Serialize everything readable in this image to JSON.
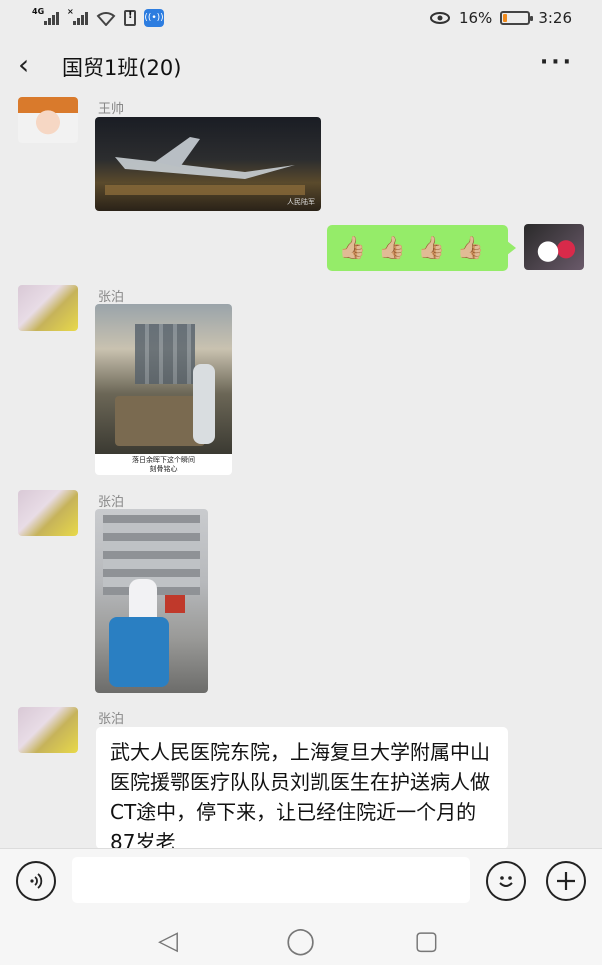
{
  "status_bar": {
    "network": "4G",
    "battery_percent": "16%",
    "battery_level": 0.16,
    "time": "3:26",
    "battery_color": "#f08a1c"
  },
  "header": {
    "back_icon": "chevron-left-icon",
    "title": "国贸1班(20)",
    "more_icon": "more-dots-icon",
    "more_label": "···"
  },
  "messages": [
    {
      "sender": "王帅",
      "type": "image",
      "avatar": "child-avatar",
      "image_caption": "人民陆军"
    },
    {
      "sender": "me",
      "type": "text",
      "content": "👍🏼👍🏼👍🏼👍🏼",
      "bubble_color": "#95ec69"
    },
    {
      "sender": "张泊",
      "type": "image",
      "image_caption": "落日余晖下这个瞬间\n刻骨铭心"
    },
    {
      "sender": "张泊",
      "type": "image"
    },
    {
      "sender": "张泊",
      "type": "text",
      "content": "武大人民医院东院，上海复旦大学附属中山医院援鄂医疗队队员刘凯医生在护送病人做CT途中，停下来，让已经住院近一个月的87岁老"
    }
  ],
  "input_bar": {
    "voice_icon": "voice-icon",
    "emoji_icon": "emoji-icon",
    "plus_icon": "plus-icon",
    "placeholder": ""
  },
  "nav_bar": {
    "back": "◁",
    "home": "◯",
    "recent": "▢"
  }
}
